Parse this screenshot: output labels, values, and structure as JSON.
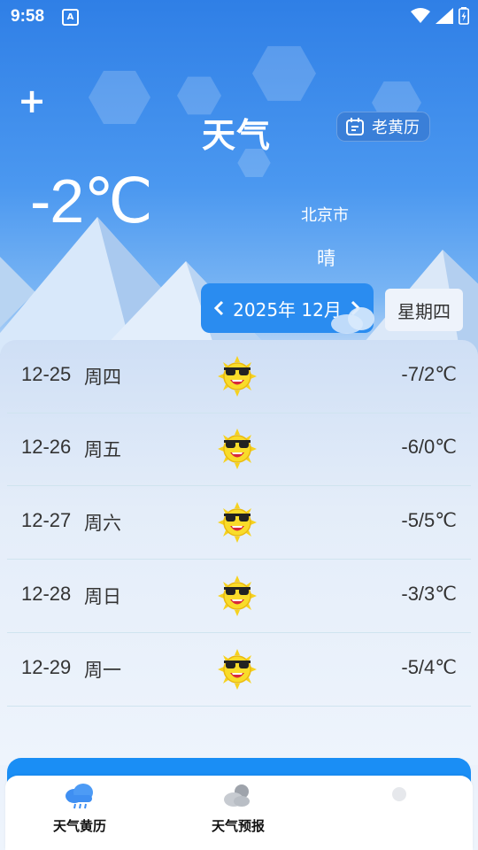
{
  "status_bar": {
    "time": "9:58",
    "notification_icon": "A"
  },
  "header": {
    "title": "天气",
    "almanac_button": "老黄历",
    "add_icon": "plus-icon"
  },
  "current": {
    "temperature": "-2℃",
    "city": "北京市",
    "condition": "晴"
  },
  "date_picker": {
    "month": "2025年 12月",
    "weekday": "星期四"
  },
  "forecast": [
    {
      "date": "12-25",
      "weekday": "周四",
      "range": "-7/2℃",
      "icon": "sunny-sunglasses-icon"
    },
    {
      "date": "12-26",
      "weekday": "周五",
      "range": "-6/0℃",
      "icon": "sunny-sunglasses-icon"
    },
    {
      "date": "12-27",
      "weekday": "周六",
      "range": "-5/5℃",
      "icon": "sunny-sunglasses-icon"
    },
    {
      "date": "12-28",
      "weekday": "周日",
      "range": "-3/3℃",
      "icon": "sunny-sunglasses-icon"
    },
    {
      "date": "12-29",
      "weekday": "周一",
      "range": "-5/4℃",
      "icon": "sunny-sunglasses-icon"
    }
  ],
  "bottom_nav": [
    {
      "label": "天气黄历",
      "icon": "rain-cloud-icon"
    },
    {
      "label": "天气预报",
      "icon": "sun-cloud-icon"
    }
  ],
  "colors": {
    "accent": "#2a8cf0",
    "text": "#333333",
    "header_bg": "#2f7fe6"
  }
}
